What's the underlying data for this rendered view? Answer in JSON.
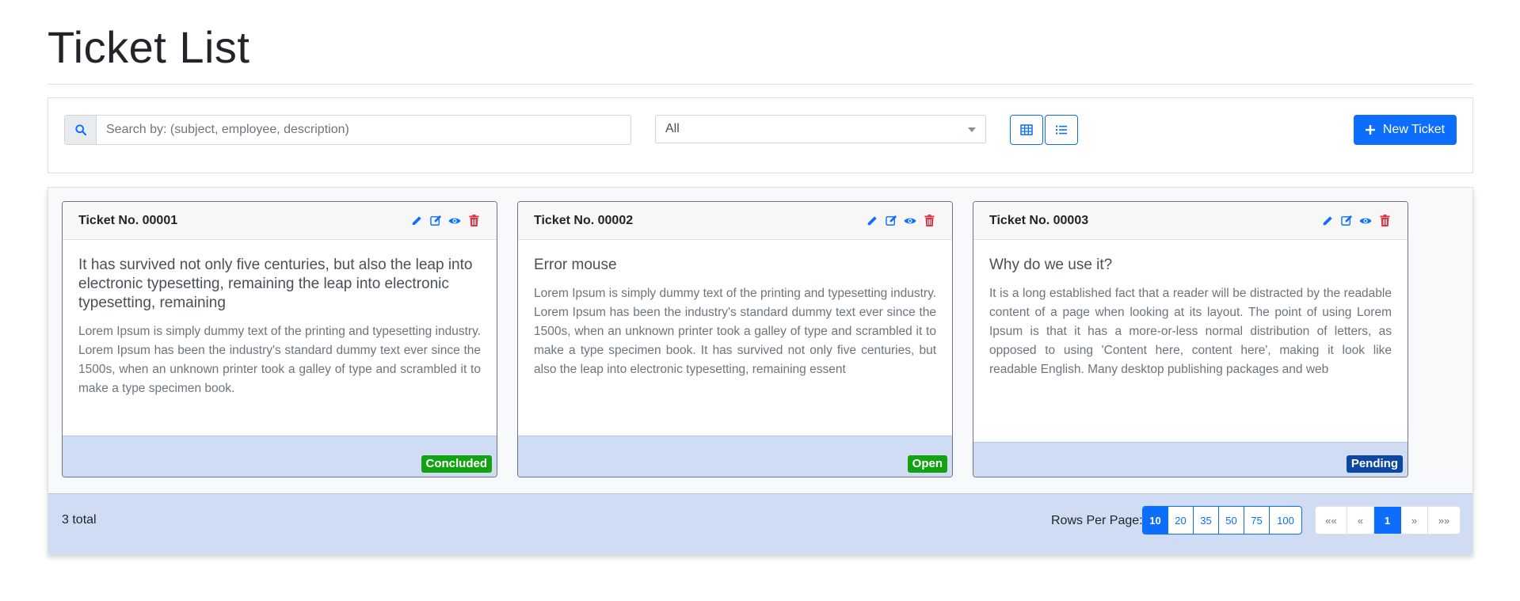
{
  "page": {
    "title": "Ticket List"
  },
  "toolbar": {
    "search_icon": "search-icon",
    "search_placeholder": "Search by: (subject, employee, description)",
    "status_filter": {
      "selected": "All"
    },
    "view_buttons": [
      "table-icon",
      "list-icon"
    ],
    "new_ticket_label": "New Ticket",
    "new_ticket_icon": "plus-icon"
  },
  "cards": [
    {
      "number": "Ticket No. 00001",
      "title": "It has survived not only five centuries, but also the leap into electronic typesetting, remaining the leap into electronic typesetting, remaining",
      "text": "Lorem Ipsum is simply dummy text of the printing and typesetting industry. Lorem Ipsum has been the industry's standard dummy text ever since the 1500s, when an unknown printer took a galley of type and scrambled it to make a type specimen book.",
      "status": "Concluded",
      "status_color": "#12a312"
    },
    {
      "number": "Ticket No. 00002",
      "title": "Error mouse",
      "text": "Lorem Ipsum is simply dummy text of the printing and typesetting industry. Lorem Ipsum has been the industry's standard dummy text ever since the 1500s, when an unknown printer took a galley of type and scrambled it to make a type specimen book. It has survived not only five centuries, but also the leap into electronic typesetting, remaining essent",
      "status": "Open",
      "status_color": "#12a312"
    },
    {
      "number": "Ticket No. 00003",
      "title": "Why do we use it?",
      "text": "It is a long established fact that a reader will be distracted by the readable content of a page when looking at its layout. The point of using Lorem Ipsum is that it has a more-or-less normal distribution of letters, as opposed to using 'Content here, content here', making it look like readable English. Many desktop publishing packages and web",
      "status": "Pending",
      "status_color": "#0d47a1"
    }
  ],
  "card_actions": [
    "pencil-icon",
    "edit-icon",
    "eye-icon",
    "trash-icon"
  ],
  "footer": {
    "total": "3 total",
    "rows_per_page_label": "Rows Per Page:",
    "rows_options": [
      "10",
      "20",
      "35",
      "50",
      "75",
      "100"
    ],
    "rows_selected": "10",
    "pagination": [
      "««",
      "«",
      "1",
      "»",
      "»»"
    ],
    "current_page": "1"
  },
  "colors": {
    "accent": "#0d6efd",
    "footer_bg": "#cfdcf4",
    "danger": "#dc3545",
    "success": "#12a312",
    "pending": "#0d47a1"
  }
}
